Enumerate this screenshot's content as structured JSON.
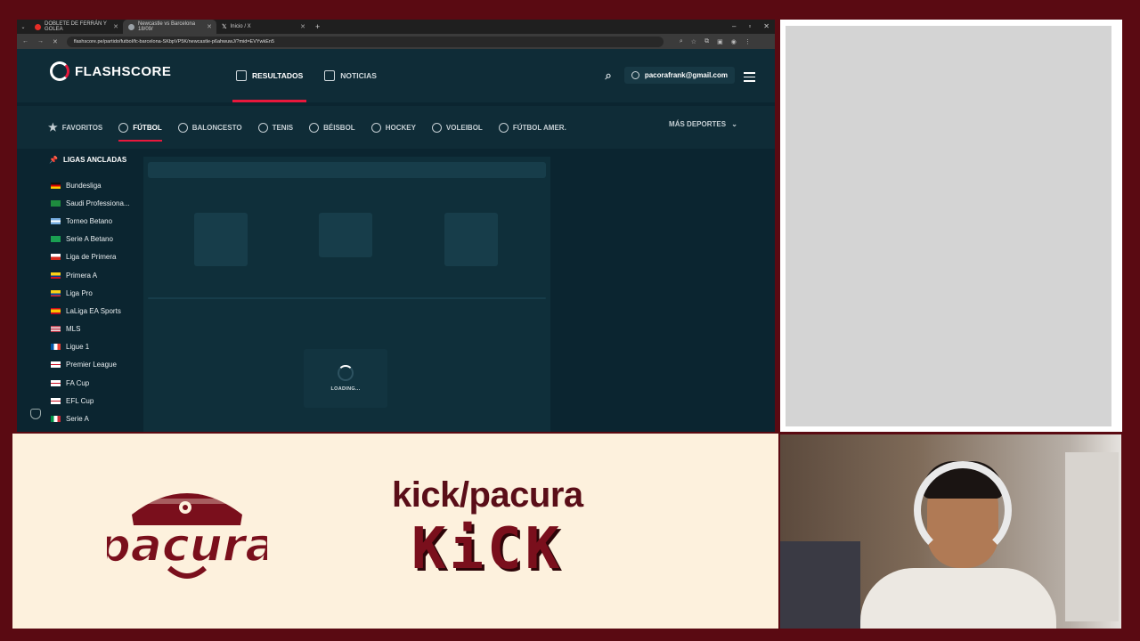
{
  "browser": {
    "tabs": [
      {
        "label": "DOBLETE DE FERRÁN Y GOLEA",
        "favicon_color": "#e52d27",
        "active": false
      },
      {
        "label": "Newcastle vs Barcelona 18/09/",
        "favicon_color": "#9aa0a6",
        "active": true
      },
      {
        "label": "Inicio / X",
        "favicon_color": "#ffffff",
        "active": false
      }
    ],
    "new_tab": "+",
    "url": "flashscore.pe/partido/futbol/fc-barcelona-SKbpVP5K/newcastle-p6ahwuwJ/?mid=EVYwkEn5"
  },
  "flashscore": {
    "logo_text": "FLASHSCORE",
    "nav": {
      "results": "RESULTADOS",
      "news": "NOTICIAS"
    },
    "user_email": "pacorafrank@gmail.com",
    "sports": [
      "FAVORITOS",
      "FÚTBOL",
      "BALONCESTO",
      "TENIS",
      "BÉISBOL",
      "HOCKEY",
      "VOLEIBOL",
      "FÚTBOL AMER."
    ],
    "more_sports": "MÁS DEPORTES",
    "pinned_title": "LIGAS ANCLADAS",
    "leagues": [
      {
        "name": "Bundesliga",
        "flag": "germany"
      },
      {
        "name": "Saudi Professiona...",
        "flag": "saudi-arabia"
      },
      {
        "name": "Torneo Betano",
        "flag": "argentina"
      },
      {
        "name": "Serie A Betano",
        "flag": "brazil"
      },
      {
        "name": "Liga de Primera",
        "flag": "chile"
      },
      {
        "name": "Primera A",
        "flag": "colombia"
      },
      {
        "name": "Liga Pro",
        "flag": "ecuador"
      },
      {
        "name": "LaLiga EA Sports",
        "flag": "spain"
      },
      {
        "name": "MLS",
        "flag": "usa"
      },
      {
        "name": "Ligue 1",
        "flag": "france"
      },
      {
        "name": "Premier League",
        "flag": "england"
      },
      {
        "name": "FA Cup",
        "flag": "england"
      },
      {
        "name": "EFL Cup",
        "flag": "england"
      },
      {
        "name": "Serie A",
        "flag": "italy"
      }
    ],
    "loading_text": "LOADING..."
  },
  "overlay": {
    "kick_handle": "kick/pacura",
    "kick_logo": "KiCK",
    "brand_name": "pacura"
  },
  "colors": {
    "frame": "#5a0a12",
    "accent": "#e8183c",
    "cream": "#fdf1dd"
  }
}
